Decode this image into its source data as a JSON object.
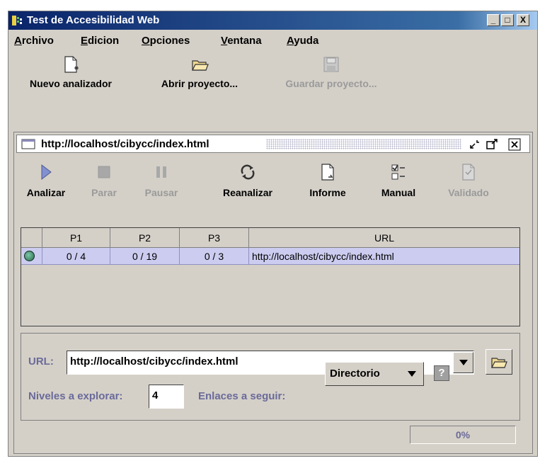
{
  "window": {
    "title": "Test de Accesibilidad Web",
    "min": "_",
    "max": "□",
    "close": "X"
  },
  "menu": [
    {
      "mnemonic": "A",
      "rest": "rchivo"
    },
    {
      "mnemonic": "E",
      "rest": "dicion"
    },
    {
      "mnemonic": "O",
      "rest": "pciones"
    },
    {
      "mnemonic": "V",
      "rest": "entana"
    },
    {
      "mnemonic": "A",
      "rest": "yuda"
    }
  ],
  "toolbar": {
    "new": "Nuevo analizador",
    "open": "Abrir proyecto...",
    "save": "Guardar proyecto..."
  },
  "frame": {
    "title": "http://localhost/cibycc/index.html"
  },
  "inner_toolbar": {
    "analyze": "Analizar",
    "stop": "Parar",
    "pause": "Pausar",
    "reanalyze": "Reanalizar",
    "report": "Informe",
    "manual": "Manual",
    "validated": "Validado"
  },
  "table": {
    "headers": [
      "P1",
      "P2",
      "P3",
      "URL"
    ],
    "rows": [
      {
        "p1": "0 / 4",
        "p2": "0 / 19",
        "p3": "0 / 3",
        "url": "http://localhost/cibycc/index.html"
      }
    ]
  },
  "form": {
    "url_label": "URL:",
    "url_value": "http://localhost/cibycc/index.html",
    "levels_label": "Niveles a explorar:",
    "levels_value": "4",
    "links_label": "Enlaces a seguir:",
    "links_value": "Directorio",
    "help": "?"
  },
  "status": {
    "progress_text": "0%",
    "progress": 0
  }
}
